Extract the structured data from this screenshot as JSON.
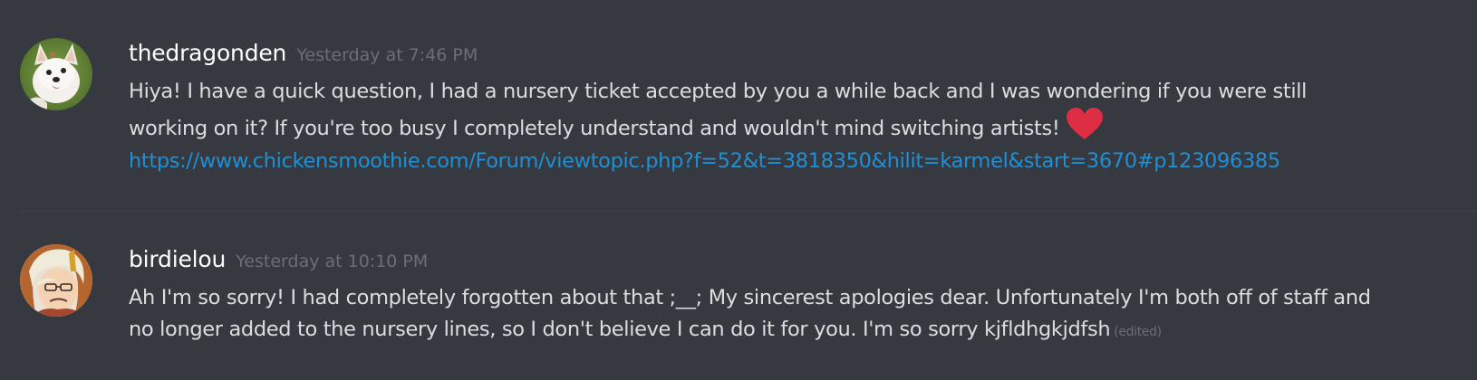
{
  "messages": [
    {
      "username": "thedragonden",
      "timestamp": "Yesterday at 7:46 PM",
      "lines": [
        "Hiya! I have a quick question, I had a nursery ticket accepted by you a while back and I was wondering if you were still",
        "working on it? If you're too busy I completely understand and wouldn't mind switching artists!"
      ],
      "emoji": "heart-emoji",
      "link": "https://www.chickensmoothie.com/Forum/viewtopic.php?f=52&t=3818350&hilit=karmel&start=3670#p123096385"
    },
    {
      "username": "birdielou",
      "timestamp": "Yesterday at 10:10 PM",
      "lines": [
        "Ah I'm so sorry! I had completely forgotten about that ;__; My sincerest apologies dear. Unfortunately I'm both off of staff and",
        "no longer added to the nursery lines, so I don't believe I can do it for you. I'm so sorry kjfldhgkjdfsh"
      ],
      "edited_label": "(edited)"
    }
  ],
  "colors": {
    "background": "#36393f",
    "username": "#ffffff",
    "text": "#dcddde",
    "timestamp": "#6b6e73",
    "link": "#1e90d6",
    "heart": "#dd2e44"
  }
}
